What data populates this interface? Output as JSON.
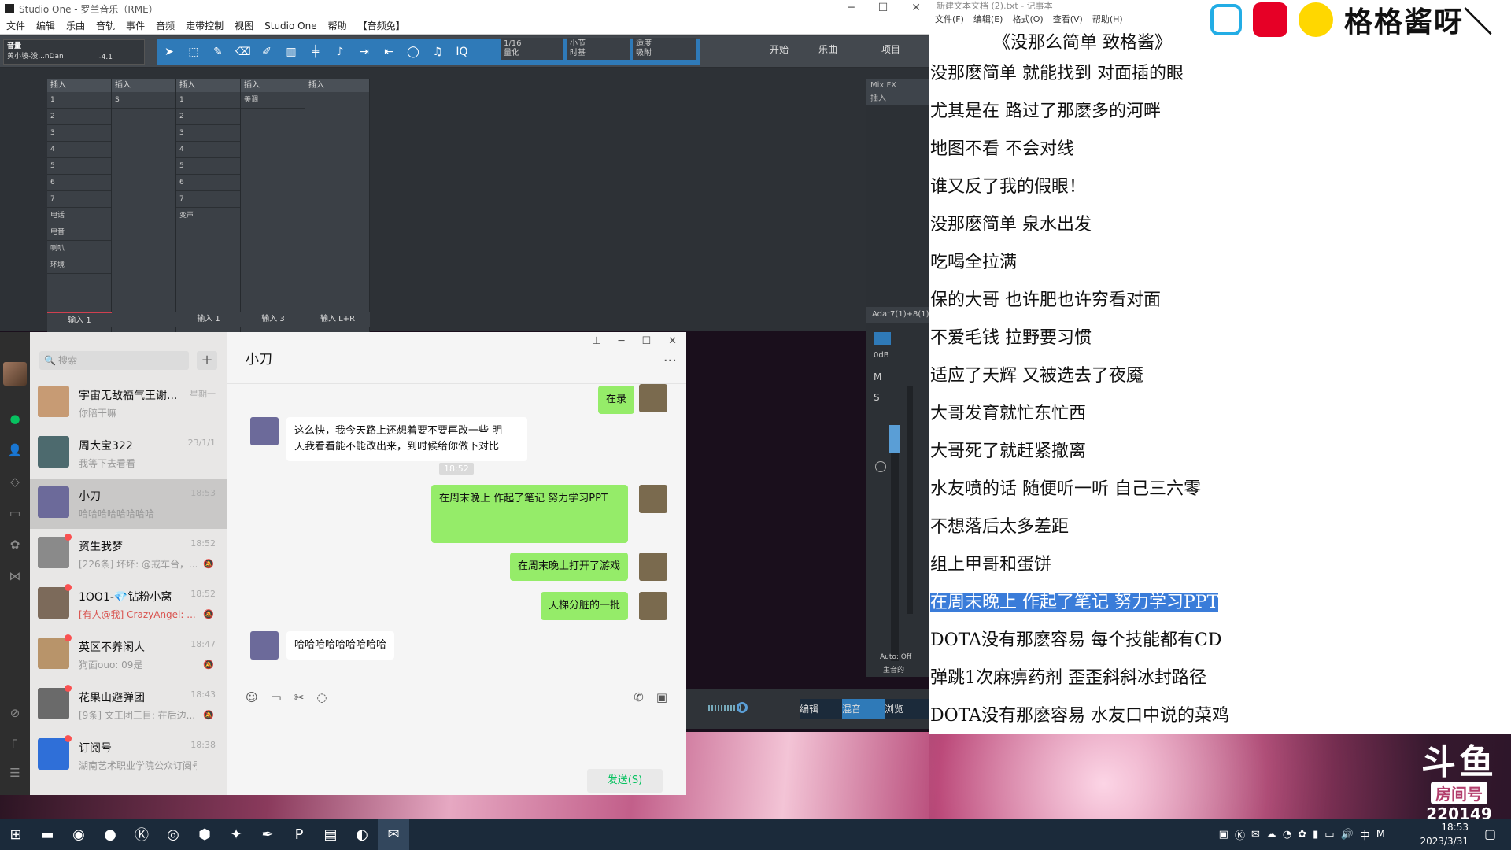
{
  "studio_one": {
    "title": "Studio One - 罗兰音乐（RME）",
    "menu": [
      "文件",
      "编辑",
      "乐曲",
      "音轨",
      "事件",
      "音频",
      "走带控制",
      "视图",
      "Studio One",
      "帮助",
      "【音频兔】"
    ],
    "volume": {
      "label": "音量",
      "sub": "黄小坡-没...nDan",
      "value": "-4.1"
    },
    "quantize": {
      "value": "1/16",
      "label": "量化"
    },
    "timebase": {
      "value": "小节",
      "label": "时基"
    },
    "snap": {
      "value": "适度",
      "label": "吸附"
    },
    "buttons": {
      "start": "开始",
      "song": "乐曲",
      "project": "项目"
    },
    "insert_label": "插入",
    "mixfx_label": "Mix FX",
    "channels": [
      {
        "inserts": [
          "1",
          "2",
          "3",
          "4",
          "5",
          "6",
          "7",
          "电话",
          "电音",
          "喇叭",
          "环境"
        ],
        "name": "输入 1"
      },
      {
        "inserts": [
          "S"
        ],
        "name": ""
      },
      {
        "inserts": [
          "1",
          "2",
          "3",
          "4",
          "5",
          "6",
          "7",
          "变声"
        ],
        "name": "输入 1"
      },
      {
        "inserts": [
          "美调"
        ],
        "name": "输入 3"
      },
      {
        "inserts": [],
        "name": "输入 L+R"
      }
    ],
    "master": {
      "device": "Adat7(1)+8(1)",
      "db": "0dB",
      "mute": "M",
      "solo": "S",
      "auto": "Auto: Off",
      "name": "主音的"
    },
    "bottom_tabs": [
      "编辑",
      "混音",
      "浏览"
    ]
  },
  "wechat": {
    "search_placeholder": "搜索",
    "chat_name": "小刀",
    "contacts": [
      {
        "name": "宇宙无敌福气王谢...",
        "time": "星期一",
        "preview": "你陪干嘛",
        "color": "#c79b74",
        "dot": false,
        "mute": false
      },
      {
        "name": "周大宝322",
        "time": "23/1/1",
        "preview": "我等下去看看",
        "color": "#4d6a6e",
        "dot": false,
        "mute": false
      },
      {
        "name": "小刀",
        "time": "18:53",
        "preview": "哈哈哈哈哈哈哈哈",
        "color": "#6c6a9a",
        "dot": false,
        "mute": false
      },
      {
        "name": "资生我梦",
        "time": "18:52",
        "preview": "[226条] 坏坏: @戒车台，...",
        "color": "#8a8a8a",
        "dot": true,
        "mute": true
      },
      {
        "name": "1OO1-💎钻粉小窝",
        "time": "18:52",
        "preview": "[有人@我] CrazyAngel: ...",
        "color": "#7c6a5a",
        "dot": true,
        "mute": true
      },
      {
        "name": "英区不养闲人",
        "time": "18:47",
        "preview": "狗面ouo: 09是",
        "color": "#b8946a",
        "dot": true,
        "mute": true
      },
      {
        "name": "花果山避弹团",
        "time": "18:43",
        "preview": "[9条] 文工团三目: 在后边...",
        "color": "#6a6a6a",
        "dot": true,
        "mute": true
      },
      {
        "name": "订阅号",
        "time": "18:38",
        "preview": "湖南艺术职业学院公众订阅号...",
        "color": "#2f6fd8",
        "dot": true,
        "mute": false
      }
    ],
    "messages": {
      "m1": "在录",
      "m2_line1": "这么快，我今天路上还想着要不要再改一些   明",
      "m2_line2": "天我看看能不能改出来，到时候给你做下对比",
      "stamp": "18:52",
      "m3": "在周末晚上 作起了笔记 努力学习PPT",
      "m4": "在周末晚上打开了游戏",
      "m5": "天梯分脏的一批",
      "m6": "哈哈哈哈哈哈哈哈哈"
    },
    "send_label": "发送(S)"
  },
  "notepad": {
    "title": "新建文本文档 (2).txt - 记事本",
    "menu": [
      "文件(F)",
      "编辑(E)",
      "格式(O)",
      "查看(V)",
      "帮助(H)"
    ],
    "streamer": "格格酱呀＼",
    "doc_title": "《没那么简单 致格酱》",
    "lines": [
      "没那麽简单 就能找到 对面插的眼",
      "尤其是在 路过了那麽多的河畔",
      "地图不看 不会对线",
      "谁又反了我的假眼！",
      "没那麽简单 泉水出发",
      "吃喝全拉满",
      "保的大哥 也许肥也许穷看对面",
      "不爱毛钱 拉野要习惯",
      "适应了天辉 又被选去了夜魇",
      "大哥发育就忙东忙西",
      "大哥死了就赶紧撤离",
      "水友喷的话 随便听一听 自己三六零",
      "不想落后太多差距",
      "组上甲哥和蛋饼"
    ],
    "highlight": "在周末晚上 作起了笔记 努力学习PPT",
    "lines2": [
      "DOTA没有那麽容易 每个技能都有CD",
      "弹跳1次麻痹药剂 歪歪斜斜冰封路径",
      "DOTA没有那麽容易 水友口中说的菜鸡"
    ]
  },
  "douyu": {
    "logo": "斗鱼",
    "label": "房间号",
    "room": "220149"
  },
  "taskbar": {
    "time": "18:53",
    "date": "2023/3/31",
    "ime": "中",
    "ime2": "M"
  }
}
